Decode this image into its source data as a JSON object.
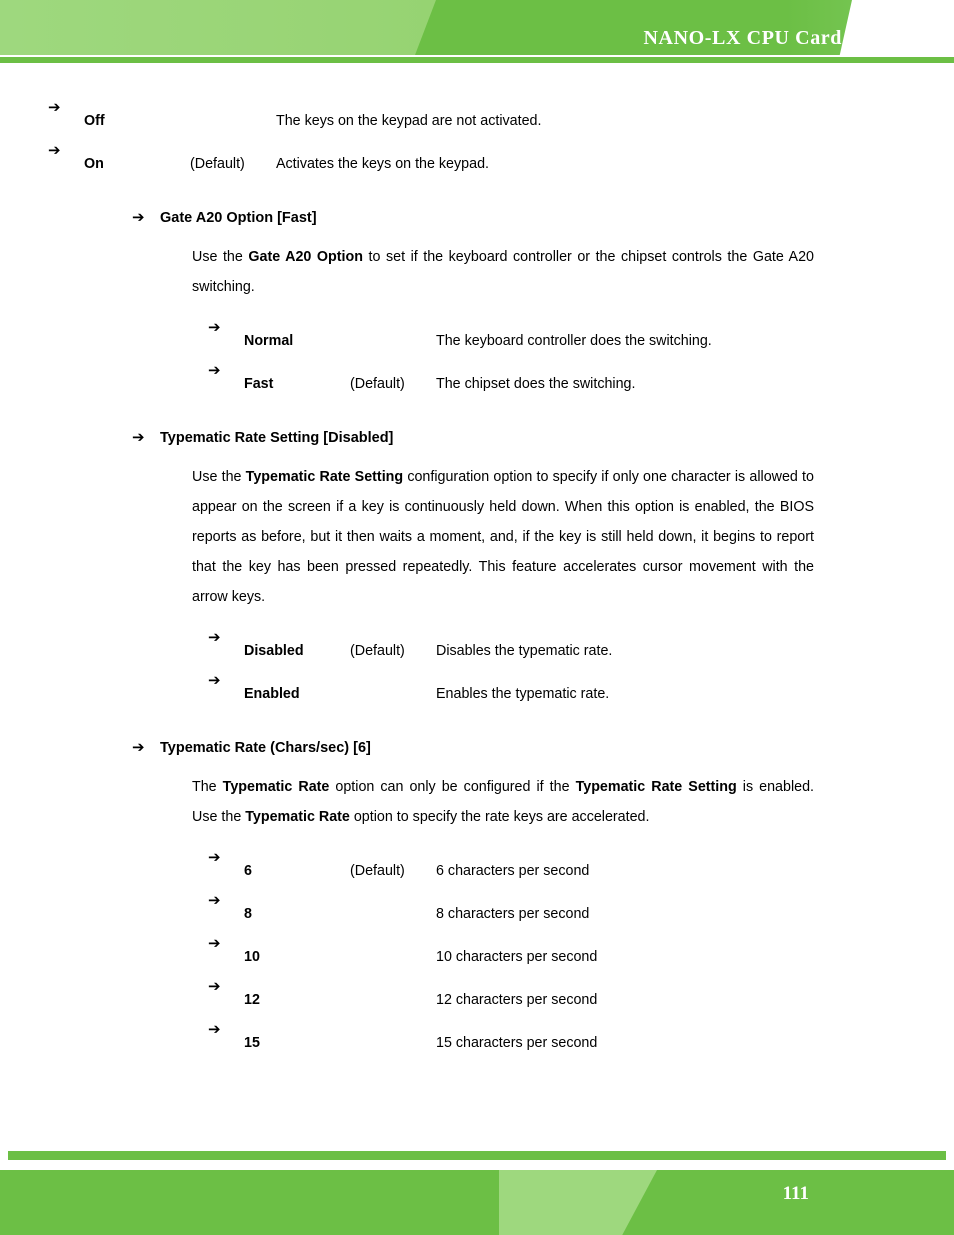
{
  "header": {
    "title": "NANO-LX CPU Card",
    "band_color_light": "#9ed87e",
    "band_color_dark": "#6cbf45"
  },
  "footer": {
    "page_number": "111",
    "band_color": "#6cbf45",
    "trapezoid_color": "#9ed87e"
  },
  "top_options": [
    {
      "arrow": "➔",
      "name": "Off",
      "default": "",
      "desc": "The keys on the keypad are not activated."
    },
    {
      "arrow": "➔",
      "name": "On",
      "default": "(Default)",
      "desc": "Activates the keys on the keypad."
    }
  ],
  "sections": [
    {
      "arrow": "➔",
      "heading": "Gate A20 Option [Fast]",
      "paragraph_html": "Use the <b>Gate A20 Option</b> to set if the keyboard controller or the chipset controls the Gate A20 switching.",
      "options": [
        {
          "arrow": "➔",
          "name": "Normal",
          "default": "",
          "desc": "The keyboard controller does the switching."
        },
        {
          "arrow": "➔",
          "name": "Fast",
          "default": "(Default)",
          "desc": "The chipset does the switching."
        }
      ]
    },
    {
      "arrow": "➔",
      "heading": "Typematic Rate Setting [Disabled]",
      "paragraph_html": "Use the <b>Typematic Rate Setting</b> configuration option to specify if only one character is allowed to appear on the screen if a key is continuously held down. When this option is enabled, the BIOS reports as before, but it then waits a moment, and, if the key is still held down, it begins to report that the key has been pressed repeatedly. This feature accelerates cursor movement with the arrow keys.",
      "options": [
        {
          "arrow": "➔",
          "name": "Disabled",
          "default": "(Default)",
          "desc": "Disables the typematic rate."
        },
        {
          "arrow": "➔",
          "name": "Enabled",
          "default": "",
          "desc": "Enables the typematic rate."
        }
      ]
    },
    {
      "arrow": "➔",
      "heading": "Typematic Rate (Chars/sec) [6]",
      "paragraph_html": "The <b>Typematic Rate</b> option can only be configured if the <b>Typematic Rate Setting</b> is enabled. Use the <b>Typematic Rate</b> option to specify the rate keys are accelerated.",
      "options": [
        {
          "arrow": "➔",
          "name": "6",
          "default": "(Default)",
          "desc": "6 characters per second"
        },
        {
          "arrow": "➔",
          "name": "8",
          "default": "",
          "desc": "8 characters per second"
        },
        {
          "arrow": "➔",
          "name": "10",
          "default": "",
          "desc": "10 characters per second"
        },
        {
          "arrow": "➔",
          "name": "12",
          "default": "",
          "desc": "12 characters per second"
        },
        {
          "arrow": "➔",
          "name": "15",
          "default": "",
          "desc": "15 characters per second"
        }
      ]
    }
  ]
}
